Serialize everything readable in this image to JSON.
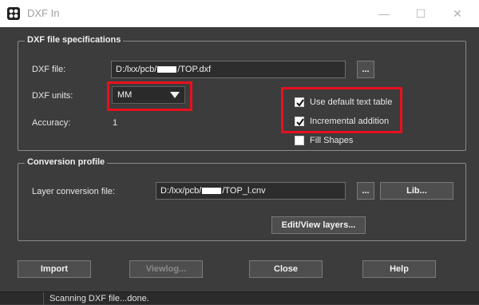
{
  "window": {
    "title": "DXF In",
    "min_glyph": "—",
    "max_glyph": "☐",
    "close_glyph": "✕"
  },
  "dxf_spec": {
    "group_title": "DXF file specifications",
    "file_label": "DXF file:",
    "file_value_prefix": "D:/lxx/pcb/",
    "file_value_suffix": "/TOP.dxf",
    "browse_label": "...",
    "units_label": "DXF units:",
    "units_selected": "MM",
    "accuracy_label": "Accuracy:",
    "accuracy_value": "1",
    "use_default_text_table": {
      "label": "Use default text table",
      "checked": true
    },
    "incremental_addition": {
      "label": "Incremental addition",
      "checked": true
    },
    "fill_shapes": {
      "label": "Fill Shapes",
      "checked": false
    }
  },
  "conversion": {
    "group_title": "Conversion profile",
    "layer_label": "Layer conversion file:",
    "layer_value_prefix": "D:/lxx/pcb/",
    "layer_value_suffix": "/TOP_l.cnv",
    "browse_label": "...",
    "lib_label": "Lib...",
    "edit_view_label": "Edit/View layers..."
  },
  "actions": {
    "import_label": "Import",
    "viewlog_label": "Viewlog...",
    "close_label": "Close",
    "help_label": "Help"
  },
  "status": {
    "text": "Scanning DXF file...done."
  },
  "colors": {
    "highlight": "#e8101e",
    "background": "#3c3c3c"
  }
}
